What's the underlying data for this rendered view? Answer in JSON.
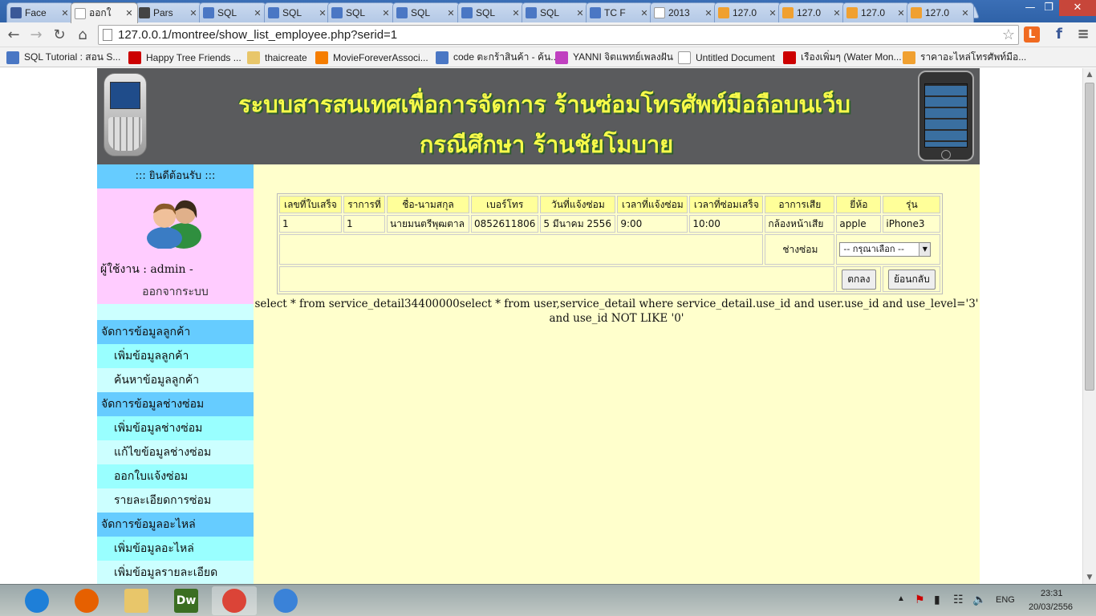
{
  "browser": {
    "tabs": [
      {
        "title": "Face",
        "favicon": "facebook-icon",
        "color": "#3b5998",
        "active": false
      },
      {
        "title": "ออกใ",
        "favicon": "page-icon",
        "color": "#ffffff",
        "active": true
      },
      {
        "title": "Pars",
        "favicon": "code-icon",
        "color": "#444444",
        "active": false
      },
      {
        "title": "SQL",
        "favicon": "w3-icon",
        "color": "#4a77c4",
        "active": false
      },
      {
        "title": "SQL",
        "favicon": "w3-icon",
        "color": "#4a77c4",
        "active": false
      },
      {
        "title": "SQL",
        "favicon": "loading-icon",
        "color": "#4a77c4",
        "active": false
      },
      {
        "title": "SQL",
        "favicon": "loading-icon",
        "color": "#4a77c4",
        "active": false
      },
      {
        "title": "SQL",
        "favicon": "loading-icon",
        "color": "#4a77c4",
        "active": false
      },
      {
        "title": "SQL",
        "favicon": "w3-icon",
        "color": "#4a77c4",
        "active": false
      },
      {
        "title": "TC F",
        "favicon": "w3-icon",
        "color": "#4a77c4",
        "active": false
      },
      {
        "title": "2013",
        "favicon": "page-icon",
        "color": "#ffffff",
        "active": false
      },
      {
        "title": "127.0",
        "favicon": "pma-icon",
        "color": "#f0a030",
        "active": false
      },
      {
        "title": "127.0",
        "favicon": "pma-icon",
        "color": "#f0a030",
        "active": false
      },
      {
        "title": "127.0",
        "favicon": "pma-icon",
        "color": "#f0a030",
        "active": false
      },
      {
        "title": "127.0",
        "favicon": "pma-icon",
        "color": "#f0a030",
        "active": false
      }
    ],
    "url": "127.0.0.1/montree/show_list_employee.php?serid=1",
    "bookmarks": [
      {
        "label": "SQL Tutorial : สอน S...",
        "icon": "w3-icon",
        "color": "#4a77c4"
      },
      {
        "label": "Happy Tree Friends ...",
        "icon": "youtube-icon",
        "color": "#cc0000"
      },
      {
        "label": "thaicreate",
        "icon": "folder-icon",
        "color": "#e8c66a"
      },
      {
        "label": "MovieForeverAssoci...",
        "icon": "blogger-icon",
        "color": "#f57d00"
      },
      {
        "label": "code ตะกร้าสินค้า - ค้น...",
        "icon": "google-icon",
        "color": "#4a77c4"
      },
      {
        "label": "YANNI จิตแพทย์เพลงฝัน",
        "icon": "music-icon",
        "color": "#c040c0"
      },
      {
        "label": "Untitled Document",
        "icon": "page-icon",
        "color": "#ffffff"
      },
      {
        "label": "เรืองเพิ่มๆ (Water Mon...",
        "icon": "youtube-icon",
        "color": "#cc0000"
      },
      {
        "label": "ราคาอะไหล่โทรศัพท์มือ...",
        "icon": "p-icon",
        "color": "#f0a030"
      }
    ]
  },
  "banner": {
    "title_line1": "ระบบสารสนเทศเพื่อการจัดการ ร้านซ่อมโทรศัพท์มือถือบนเว็บ",
    "title_line2": "กรณีศึกษา ร้านชัยโมบาย"
  },
  "sidebar": {
    "welcome": "::: ยินดีต้อนรับ :::",
    "username": "ผู้ใช้งาน : admin -",
    "logout": "ออกจากระบบ",
    "sections": [
      {
        "header": "จัดการข้อมูลลูกค้า",
        "items": [
          "เพิ่มข้อมูลลูกค้า",
          "ค้นหาข้อมูลลูกค้า"
        ]
      },
      {
        "header": "จัดการข้อมูลช่างซ่อม",
        "items": [
          "เพิ่มข้อมูลช่างซ่อม",
          "แก้ไขข้อมูลช่างซ่อม",
          "ออกใบแจ้งซ่อม",
          "รายละเอียดการซ่อม"
        ]
      },
      {
        "header": "จัดการข้อมูลอะไหล่",
        "items": [
          "เพิ่มข้อมูลอะไหล่",
          "เพิ่มข้อมูลรายละเอียด"
        ]
      }
    ]
  },
  "table": {
    "headers": [
      "เลขที่ใบเสร็จ",
      "ราการที่",
      "ชื่อ-นามสกุล",
      "เบอร์โทร",
      "วันที่แจ้งซ่อม",
      "เวลาที่แจ้งซ่อม",
      "เวลาที่ซ่อมเสร็จ",
      "อาการเสีย",
      "ยี่ห้อ",
      "รุ่น"
    ],
    "row": [
      "1",
      "1",
      "นายมนตรีพุฒตาล",
      "0852611806",
      "5 มีนาคม 2556",
      "9:00",
      "10:00",
      "กล้องหน้าเสีย",
      "apple",
      "iPhone3"
    ],
    "technician_label": "ช่างซ่อม",
    "technician_select": "-- กรุณาเลือก --",
    "ok_button": "ตกลง",
    "back_button": "ย้อนกลับ"
  },
  "sql_output": "select * from service_detail34400000select * from user,service_detail where service_detail.use_id and user.use_id and use_level='3' and use_id NOT LIKE '0'",
  "taskbar": {
    "apps": [
      {
        "name": "ie-icon",
        "color": "#1e7fd8"
      },
      {
        "name": "firefox-icon",
        "color": "#e66000"
      },
      {
        "name": "explorer-icon",
        "color": "#e8c66a"
      },
      {
        "name": "dreamweaver-icon",
        "label": "Dw",
        "color": "#3b6e22"
      },
      {
        "name": "chrome-icon",
        "color": "#db4437"
      },
      {
        "name": "itunes-icon",
        "color": "#3a82d8"
      }
    ],
    "lang": "ENG",
    "time": "23:31",
    "date": "20/03/2556"
  }
}
